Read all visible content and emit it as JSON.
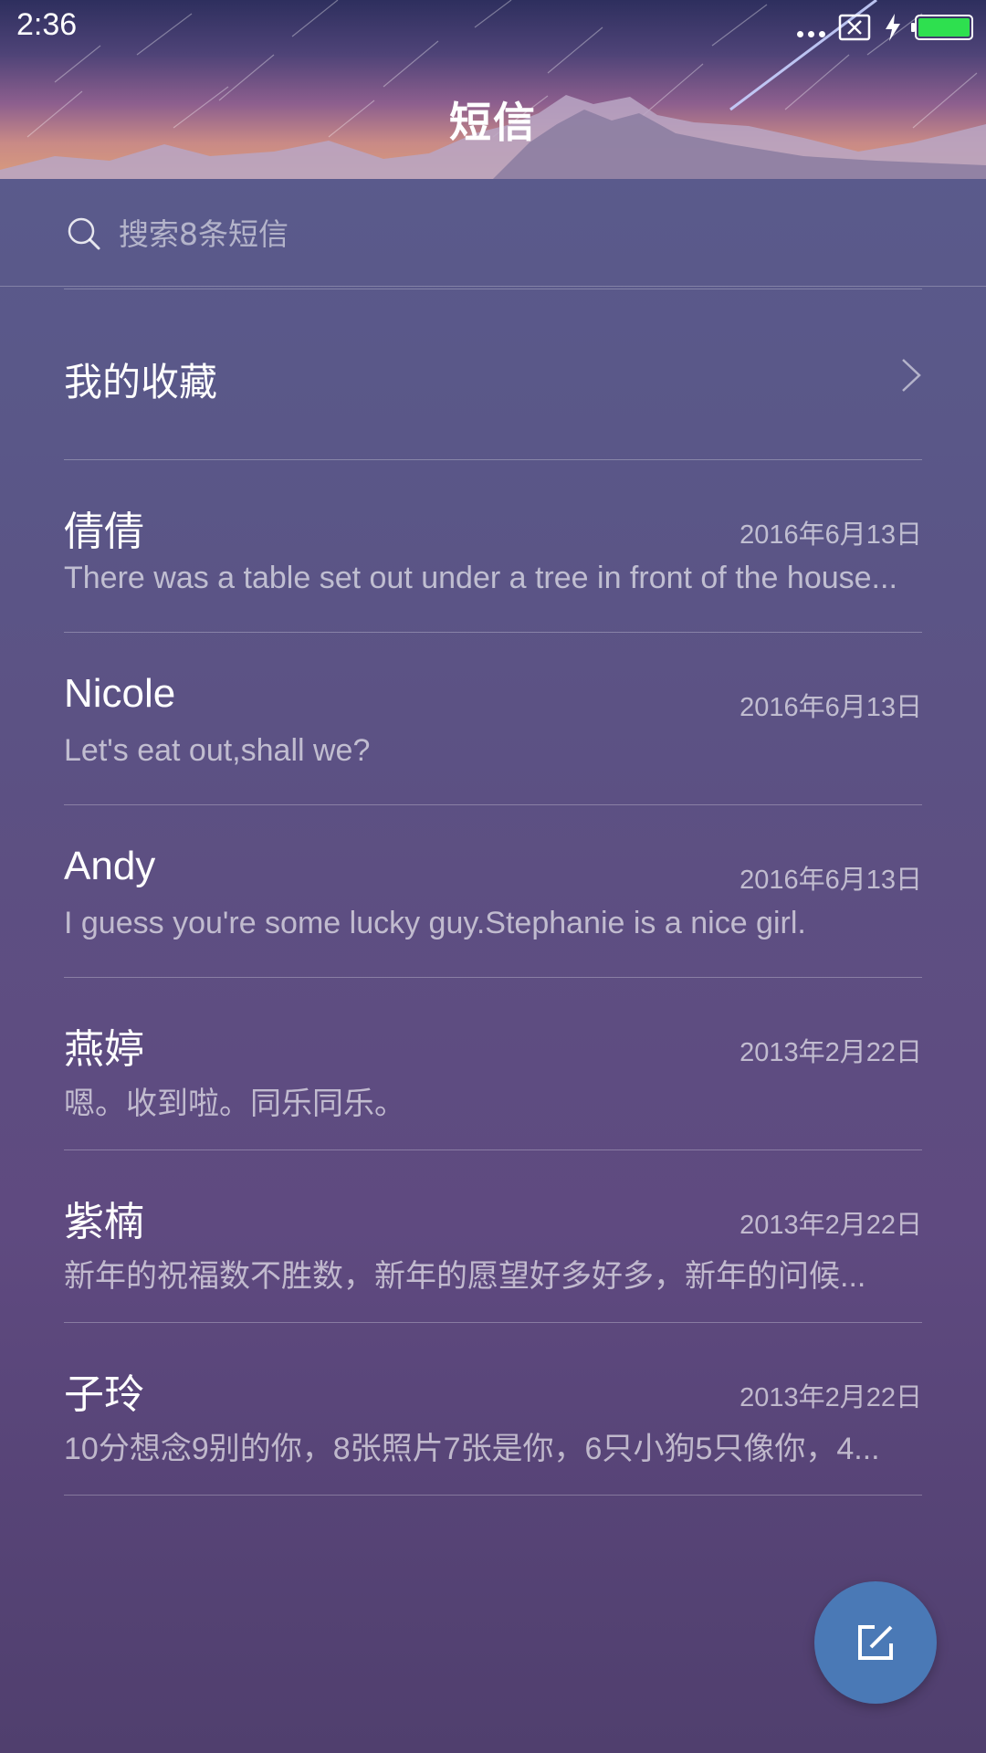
{
  "status_bar": {
    "time": "2:36"
  },
  "header": {
    "title": "短信"
  },
  "search": {
    "placeholder": "搜索8条短信"
  },
  "favorites": {
    "label": "我的收藏"
  },
  "messages": [
    {
      "name": "倩倩",
      "date": "2016年6月13日",
      "preview": "There was a table set out under a tree in front of the house..."
    },
    {
      "name": "Nicole",
      "date": "2016年6月13日",
      "preview": "Let's eat out,shall we?"
    },
    {
      "name": "Andy",
      "date": "2016年6月13日",
      "preview": "I guess you're some lucky guy.Stephanie is a nice girl."
    },
    {
      "name": "燕婷",
      "date": "2013年2月22日",
      "preview": "嗯。收到啦。同乐同乐。"
    },
    {
      "name": "紫楠",
      "date": "2013年2月22日",
      "preview": "新年的祝福数不胜数，新年的愿望好多好多，新年的问候..."
    },
    {
      "name": "子玲",
      "date": "2013年2月22日",
      "preview": "10分想念9别的你，8张照片7张是你，6只小狗5只像你，4..."
    }
  ],
  "icons": {
    "search": "search-icon",
    "chevron": "chevron-right-icon",
    "compose": "compose-icon",
    "battery": "battery-icon",
    "charging": "charging-icon",
    "no_sim": "no-sim-icon",
    "signal_dots": "more-dots-icon"
  },
  "colors": {
    "battery_fill": "#2ee04f",
    "fab": "#4a79b6"
  }
}
